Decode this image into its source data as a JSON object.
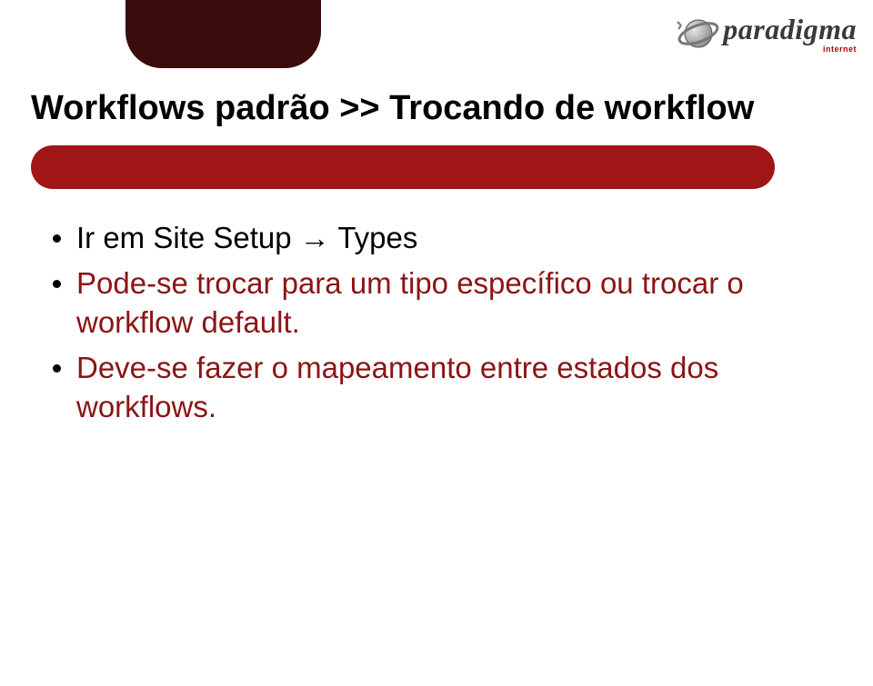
{
  "logo": {
    "word": "paradigma",
    "sub": "internet"
  },
  "title": "Workflows padrão >> Trocando de workflow",
  "bullets": [
    "Ir em Site Setup → Types",
    "Pode-se trocar para um tipo específico ou trocar o workflow default.",
    "Deve-se fazer o mapeamento entre estados dos workflows."
  ]
}
